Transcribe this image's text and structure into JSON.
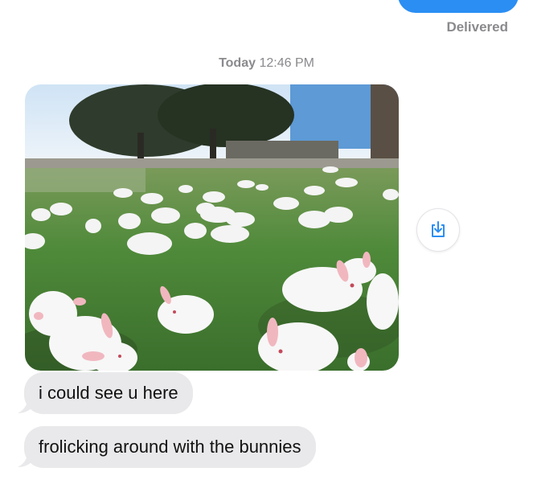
{
  "status": {
    "delivered": "Delivered"
  },
  "timestamp": {
    "day": "Today",
    "time": "12:46 PM"
  },
  "messages": [
    {
      "text": "i could see u here"
    },
    {
      "text": "frolicking around with the bunnies"
    }
  ],
  "icons": {
    "save": "download-to-device-icon"
  },
  "colors": {
    "sent_bubble": "#2b8ef3",
    "received_bubble": "#e9e9eb",
    "meta_text": "#8a8a8e",
    "save_icon": "#2b8ef3"
  }
}
